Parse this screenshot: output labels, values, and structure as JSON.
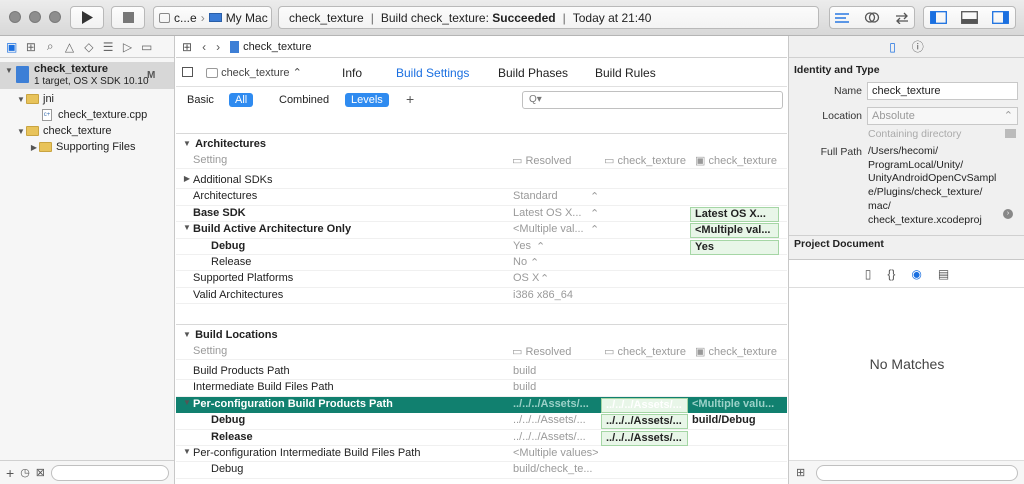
{
  "toolbar": {
    "scheme": "c...e",
    "destination": "My Mac",
    "project": "check_texture",
    "status_prefix": "Build check_texture:",
    "status_result": "Succeeded",
    "status_time": "Today at 21:40"
  },
  "navigator": {
    "project_name": "check_texture",
    "project_sub": "1 target, OS X SDK 10.10",
    "project_badge": "M",
    "items": [
      {
        "label": "jni"
      },
      {
        "label": "check_texture.cpp"
      },
      {
        "label": "check_texture"
      },
      {
        "label": "Supporting Files"
      }
    ]
  },
  "editor": {
    "jump_file": "check_texture",
    "target": "check_texture",
    "tabs": [
      "Info",
      "Build Settings",
      "Build Phases",
      "Build Rules"
    ],
    "filters": [
      "Basic",
      "All",
      "Combined",
      "Levels"
    ],
    "search_placeholder": "Q▾",
    "col_setting": "Setting",
    "col_resolved": "Resolved",
    "col_target": "check_texture",
    "col_project": "check_texture",
    "sections": [
      {
        "title": "Architectures"
      },
      {
        "title": "Build Locations"
      }
    ],
    "arch_rows": [
      {
        "name": "Additional SDKs",
        "resolved": "",
        "target": "",
        "project": ""
      },
      {
        "name": "Architectures",
        "resolved": "Standard",
        "target": "",
        "project": ""
      },
      {
        "name": "Base SDK",
        "resolved": "Latest OS X...",
        "target": "",
        "project": "Latest OS X..."
      },
      {
        "name": "Build Active Architecture Only",
        "resolved": "<Multiple val...",
        "target": "",
        "project": "<Multiple val..."
      },
      {
        "name": "Debug",
        "resolved": "Yes",
        "target": "",
        "project": "Yes"
      },
      {
        "name": "Release",
        "resolved": "No",
        "target": "",
        "project": ""
      },
      {
        "name": "Supported Platforms",
        "resolved": "OS X",
        "target": "",
        "project": ""
      },
      {
        "name": "Valid Architectures",
        "resolved": "i386 x86_64",
        "target": "",
        "project": ""
      }
    ],
    "loc_rows": [
      {
        "name": "Build Products Path",
        "resolved": "build",
        "target": "",
        "project": ""
      },
      {
        "name": "Intermediate Build Files Path",
        "resolved": "build",
        "target": "",
        "project": ""
      },
      {
        "name": "Per-configuration Build Products Path",
        "resolved": "../../../Assets/...",
        "target": "../../../Assets/...",
        "project": "<Multiple valu..."
      },
      {
        "name": "Debug",
        "resolved": "../../../Assets/...",
        "target": "../../../Assets/...",
        "project": "build/Debug"
      },
      {
        "name": "Release",
        "resolved": "../../../Assets/...",
        "target": "../../../Assets/...",
        "project": ""
      },
      {
        "name": "Per-configuration Intermediate Build Files Path",
        "resolved": "<Multiple values>",
        "target": "",
        "project": ""
      },
      {
        "name": "Debug",
        "resolved": "build/check_te...",
        "target": "",
        "project": ""
      }
    ]
  },
  "inspector": {
    "identity_title": "Identity and Type",
    "name_label": "Name",
    "name_value": "check_texture",
    "location_label": "Location",
    "location_value": "Absolute",
    "containing": "Containing directory",
    "fullpath_label": "Full Path",
    "fullpath_lines": [
      "/Users/hecomi/",
      "ProgramLocal/Unity/",
      "UnityAndroidOpenCvSampl",
      "e/Plugins/check_texture/",
      "mac/",
      "check_texture.xcodeproj"
    ],
    "project_doc_title": "Project Document",
    "no_matches": "No Matches"
  },
  "colors": {
    "accent": "#2f8bf0",
    "highlight_row": "#11806f",
    "folder": "#e8c35a"
  }
}
